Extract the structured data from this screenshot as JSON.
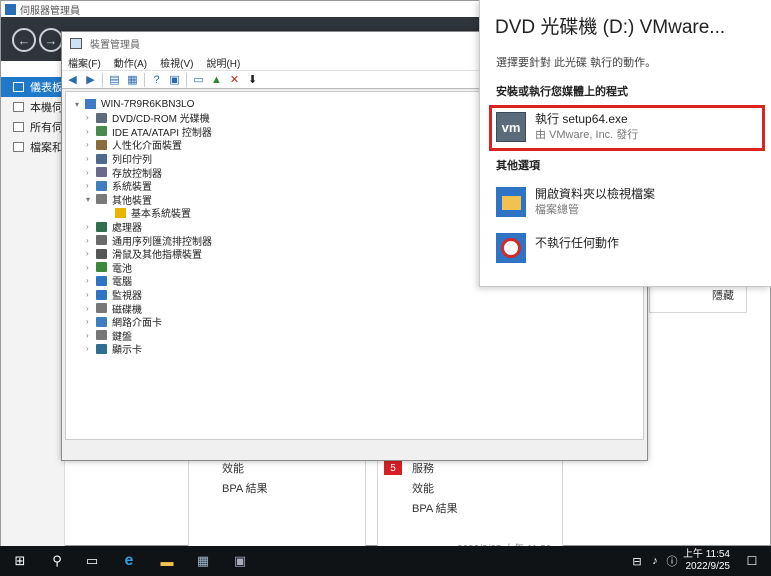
{
  "server_manager": {
    "title": "伺服器管理員",
    "nav_back": "←",
    "nav_forward": "→",
    "sidebar": [
      {
        "label": "儀表板",
        "active": true
      },
      {
        "label": "本機伺服器",
        "active": false
      },
      {
        "label": "所有伺服器",
        "active": false
      },
      {
        "label": "檔案和存放服務",
        "active": false
      }
    ],
    "tile_left": {
      "line1": "效能",
      "line2": "BPA 結果"
    },
    "tile_right": {
      "badge": "5",
      "line1": "服務",
      "line2": "效能",
      "line3": "BPA 結果"
    },
    "timestamp": "2022/9/25 上午 11:52",
    "hide_label": "隱藏"
  },
  "device_manager": {
    "title": "裝置管理員",
    "menu": [
      "檔案(F)",
      "動作(A)",
      "檢視(V)",
      "說明(H)"
    ],
    "root": "WIN-7R9R6KBN3LO",
    "items": [
      {
        "label": "DVD/CD-ROM 光碟機",
        "expanded": false
      },
      {
        "label": "IDE ATA/ATAPI 控制器",
        "expanded": false
      },
      {
        "label": "人性化介面裝置",
        "expanded": false
      },
      {
        "label": "列印佇列",
        "expanded": false
      },
      {
        "label": "存放控制器",
        "expanded": false
      },
      {
        "label": "系統裝置",
        "expanded": false
      },
      {
        "label": "其他裝置",
        "expanded": true,
        "children": [
          "基本系統裝置"
        ]
      },
      {
        "label": "處理器",
        "expanded": false
      },
      {
        "label": "通用序列匯流排控制器",
        "expanded": false
      },
      {
        "label": "滑鼠及其他指標裝置",
        "expanded": false
      },
      {
        "label": "電池",
        "expanded": false
      },
      {
        "label": "電腦",
        "expanded": false
      },
      {
        "label": "監視器",
        "expanded": false
      },
      {
        "label": "磁碟機",
        "expanded": false
      },
      {
        "label": "網路介面卡",
        "expanded": false
      },
      {
        "label": "鍵盤",
        "expanded": false
      },
      {
        "label": "顯示卡",
        "expanded": false
      }
    ]
  },
  "autoplay": {
    "title": "DVD 光碟機 (D:) VMware...",
    "subtitle": "選擇要針對 此光碟 執行的動作。",
    "section_install": "安裝或執行您媒體上的程式",
    "run_setup": {
      "title": "執行 setup64.exe",
      "desc": "由 VMware, Inc. 發行",
      "icon_text": "vm"
    },
    "section_other": "其他選項",
    "open_folder": {
      "title": "開啟資料夾以檢視檔案",
      "desc": "檔案總管"
    },
    "no_action": {
      "title": "不執行任何動作"
    }
  },
  "taskbar": {
    "time": "上午 11:54",
    "date": "2022/9/25"
  }
}
